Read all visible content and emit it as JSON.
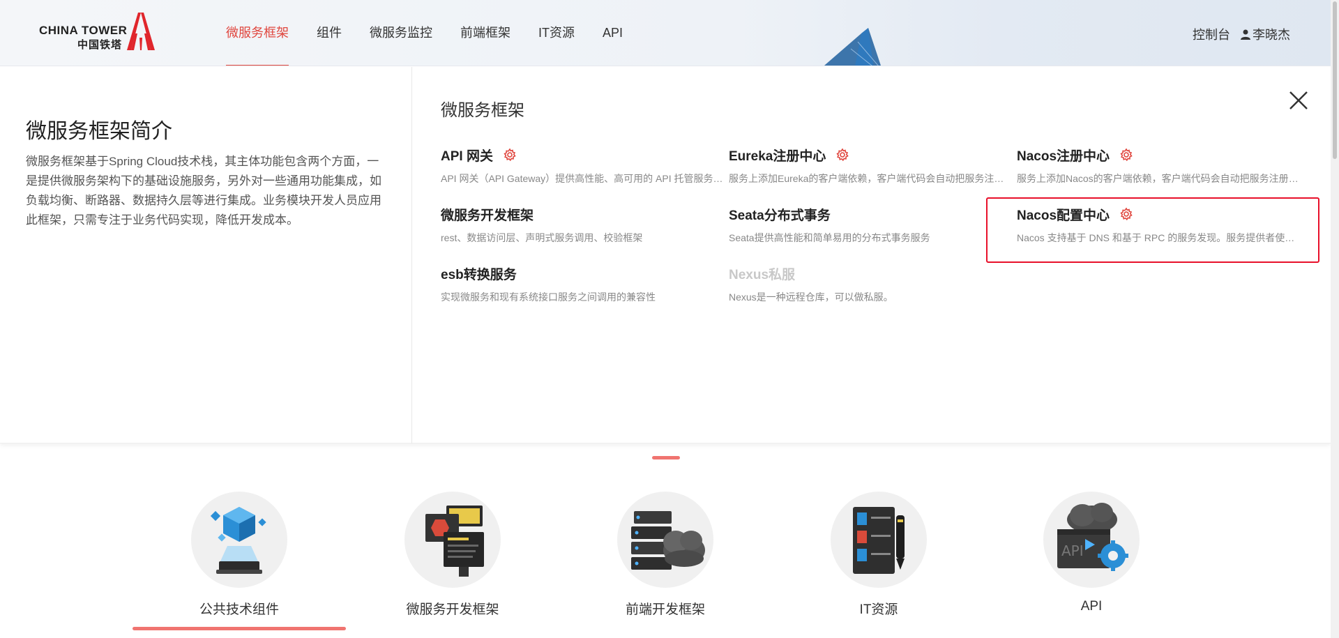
{
  "header": {
    "logo_en": "CHINA TOWER",
    "logo_cn": "中国铁塔",
    "nav": [
      {
        "label": "微服务框架",
        "active": true
      },
      {
        "label": "组件",
        "active": false
      },
      {
        "label": "微服务监控",
        "active": false
      },
      {
        "label": "前端框架",
        "active": false
      },
      {
        "label": "IT资源",
        "active": false
      },
      {
        "label": "API",
        "active": false
      }
    ],
    "console_label": "控制台",
    "user_name": "李晓杰",
    "user_icon": "user-icon"
  },
  "intro": {
    "title": "微服务框架简介",
    "text": "微服务框架基于Spring Cloud技术栈，其主体功能包含两个方面，一是提供微服务架构下的基础设施服务，另外对一些通用功能集成，如负载均衡、断路器、数据持久层等进行集成。业务模块开发人员应用此框架，只需专注于业务代码实现，降低开发成本。"
  },
  "menu": {
    "title": "微服务框架",
    "close_icon": "close-icon",
    "items": [
      {
        "title": "API 网关",
        "desc": "API 网关（API Gateway）提供高性能、高可用的 API 托管服务，帮助用户对外开放其部署在云上的后端服务",
        "gear": true,
        "disabled": false
      },
      {
        "title": "Eureka注册中心",
        "desc": "服务上添加Eureka的客户端依赖，客户端代码会自动把服务注册到EurekaServer中",
        "gear": true,
        "disabled": false
      },
      {
        "title": "Nacos注册中心",
        "desc": "服务上添加Nacos的客户端依赖，客户端代码会自动把服务注册到NacosServer中",
        "gear": true,
        "disabled": false
      },
      {
        "title": "微服务开发框架",
        "desc": "rest、数据访问层、声明式服务调用、校验框架",
        "gear": false,
        "disabled": false
      },
      {
        "title": "Seata分布式事务",
        "desc": "Seata提供高性能和简单易用的分布式事务服务",
        "gear": false,
        "disabled": false
      },
      {
        "title": "Nacos配置中心",
        "desc": "Nacos 支持基于 DNS 和基于 RPC 的服务发现。服务提供者使用原生SDK、OpenAPI注册服务",
        "gear": true,
        "disabled": false
      },
      {
        "title": "esb转换服务",
        "desc": "实现微服务和现有系统接口服务之间调用的兼容性",
        "gear": false,
        "disabled": false
      },
      {
        "title": "Nexus私服",
        "desc": "Nexus是一种远程仓库，可以做私服。",
        "gear": false,
        "disabled": true
      }
    ],
    "accent_color": "#e0463e",
    "highlight_color": "#e8102a"
  },
  "categories": [
    {
      "label": "公共技术组件",
      "icon": "server-cube-icon",
      "active": true
    },
    {
      "label": "微服务开发框架",
      "icon": "monitors-icon",
      "active": false
    },
    {
      "label": "前端开发框架",
      "icon": "server-cloud-icon",
      "active": false
    },
    {
      "label": "IT资源",
      "icon": "checklist-pen-icon",
      "active": false
    },
    {
      "label": "API",
      "icon": "api-cloud-gear-icon",
      "active": false
    }
  ]
}
